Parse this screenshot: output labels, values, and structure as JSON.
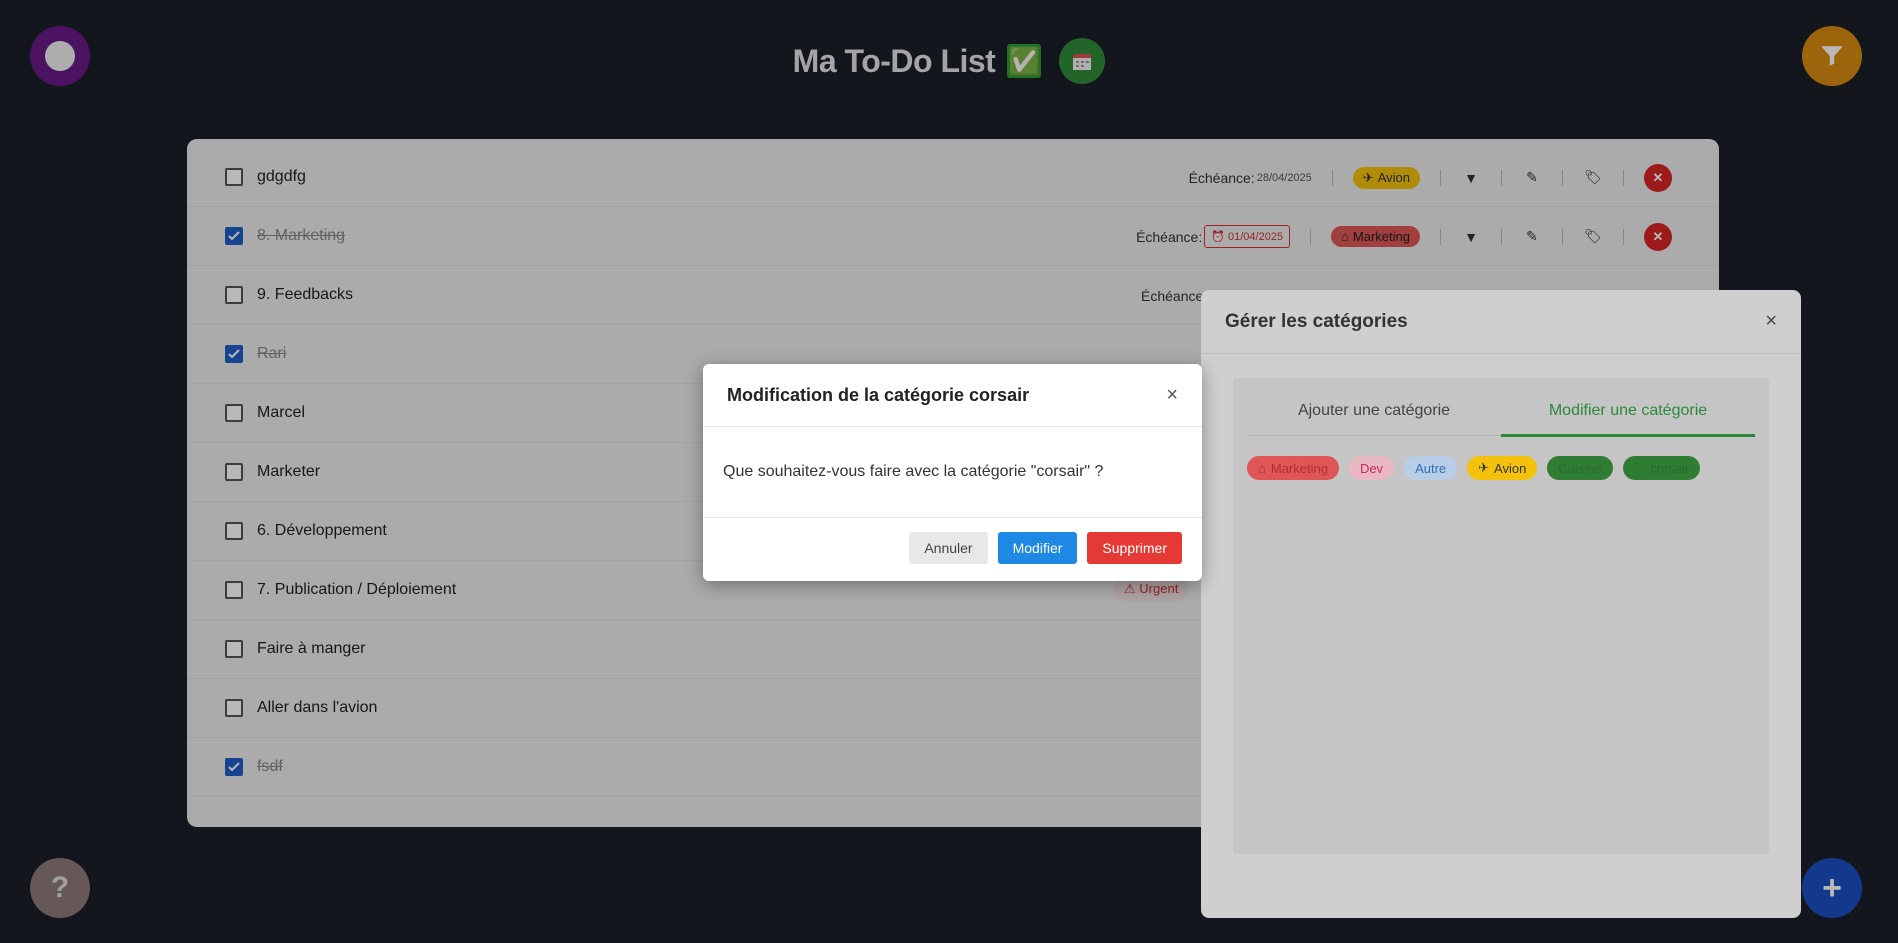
{
  "header": {
    "title": "Ma To-Do List",
    "title_emoji": "✅"
  },
  "tasks": [
    {
      "text": "gdgdfg",
      "checked": false,
      "deadline_label": "Échéance:",
      "deadline": "28/04/2025",
      "category": "Avion"
    },
    {
      "text": "8. Marketing",
      "checked": true,
      "deadline_label": "Échéance:",
      "deadline": "01/04/2025",
      "category": "Marketing"
    },
    {
      "text": "9. Feedbacks",
      "checked": false,
      "deadline_label": "Échéance"
    },
    {
      "text": "Rari",
      "checked": true
    },
    {
      "text": "Marcel",
      "checked": false
    },
    {
      "text": "Marketer",
      "checked": false
    },
    {
      "text": "6. Développement",
      "checked": false
    },
    {
      "text": "7. Publication / Déploiement",
      "checked": false,
      "tag": "Urgent"
    },
    {
      "text": "Faire à manger",
      "checked": false
    },
    {
      "text": "Aller dans l'avion",
      "checked": false
    },
    {
      "text": "fsdf",
      "checked": true
    }
  ],
  "categories_panel": {
    "title": "Gérer les catégories",
    "close": "×",
    "tabs": [
      "Ajouter une catégorie",
      "Modifier une catégorie"
    ],
    "active_tab": 1,
    "chips": [
      {
        "label": "Marketing",
        "icon": "home-icon",
        "bg": "#e05656",
        "fg": "#b03030"
      },
      {
        "label": "Dev",
        "bg": "#e9b8c2",
        "fg": "#c0305a"
      },
      {
        "label": "Autre",
        "bg": "#b8cde8",
        "fg": "#2f6fb8"
      },
      {
        "label": "Avion",
        "icon": "plane-icon",
        "bg": "#f4c20d",
        "fg": "#333"
      },
      {
        "label": "Cuisine",
        "bg": "#2e7d32",
        "fg": "#2b6b2e"
      },
      {
        "label": "corsair",
        "icon": "heart-icon",
        "bg": "#2e7d32",
        "fg": "#2b6b2e"
      }
    ]
  },
  "modal": {
    "title": "Modification de la catégorie corsair",
    "close": "×",
    "message": "Que souhaitez-vous faire avec la catégorie \"corsair\" ?",
    "cancel_label": "Annuler",
    "edit_label": "Modifier",
    "delete_label": "Supprimer"
  },
  "floating": {
    "help": "?",
    "add": "+"
  },
  "colors": {
    "background": "#1b1f29",
    "accent_green": "#2b8a3a",
    "primary_blue": "#1e88e5",
    "danger_red": "#e53935"
  }
}
